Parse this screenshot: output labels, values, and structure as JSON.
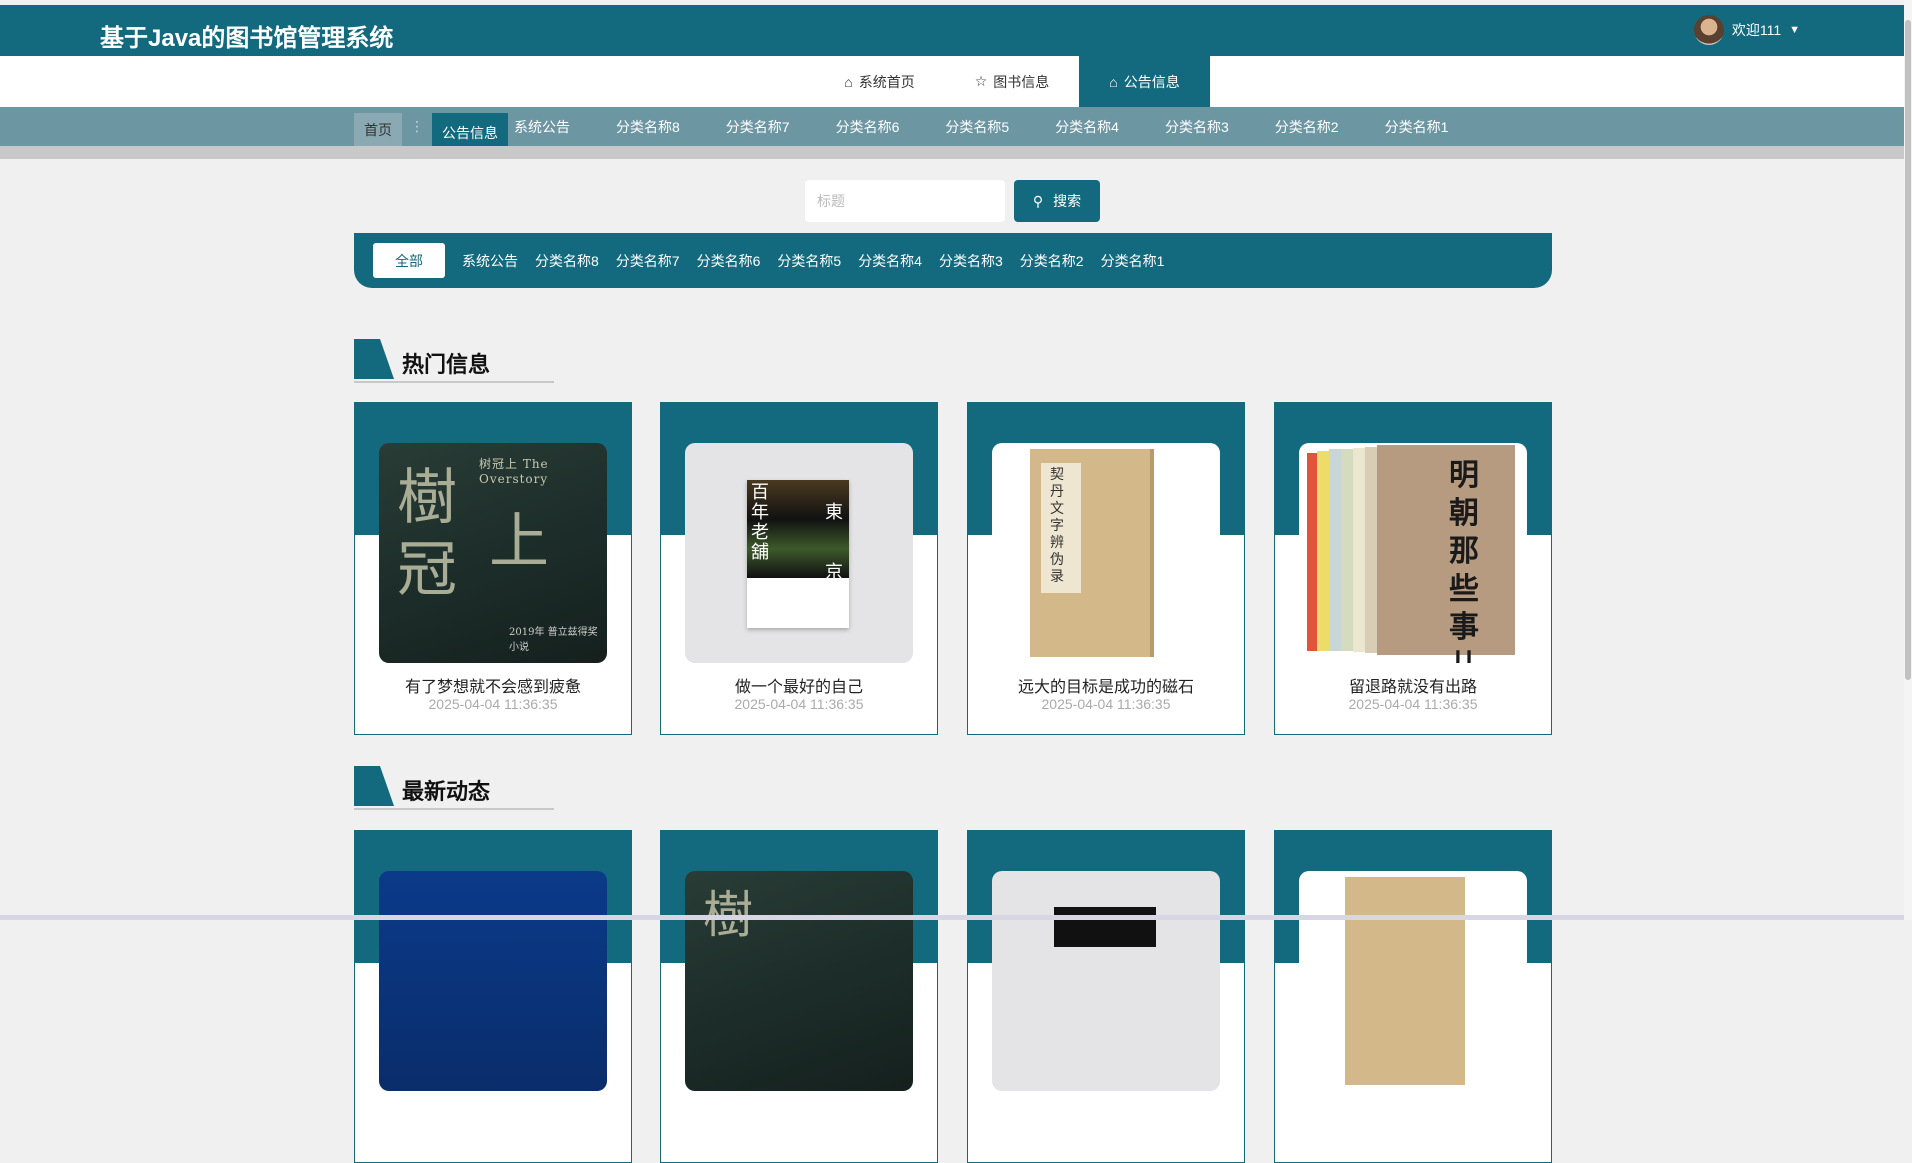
{
  "header": {
    "title": "基于Java的图书馆管理系统",
    "welcome": "欢迎111",
    "dropdown_icon": "▼"
  },
  "nav": [
    {
      "label": "系统首页",
      "icon": "home-icon"
    },
    {
      "label": "图书信息",
      "icon": "star-icon"
    },
    {
      "label": "公告信息",
      "icon": "bag-icon",
      "active": true
    }
  ],
  "breadcrumb": {
    "home": "首页",
    "separator": "⋮",
    "current": "公告信息"
  },
  "subnav_categories": [
    "系统公告",
    "分类名称8",
    "分类名称7",
    "分类名称6",
    "分类名称5",
    "分类名称4",
    "分类名称3",
    "分类名称2",
    "分类名称1"
  ],
  "search": {
    "placeholder": "标题",
    "button": "搜索"
  },
  "filter": {
    "all": "全部",
    "categories": [
      "系统公告",
      "分类名称8",
      "分类名称7",
      "分类名称6",
      "分类名称5",
      "分类名称4",
      "分类名称3",
      "分类名称2",
      "分类名称1"
    ]
  },
  "hot": {
    "title": "热门信息",
    "items": [
      {
        "title": "有了梦想就不会感到疲惫",
        "date": "2025-04-04 11:36:35",
        "cover_text": "树冠上 The Overstory"
      },
      {
        "title": "做一个最好的自己",
        "date": "2025-04-04 11:36:35",
        "cover_text": "百年老舖 東京"
      },
      {
        "title": "远大的目标是成功的磁石",
        "date": "2025-04-04 11:36:35",
        "cover_text": "契丹文字辨伪录"
      },
      {
        "title": "留退路就没有出路",
        "date": "2025-04-04 11:36:35",
        "cover_text": "明朝那些事儿"
      }
    ]
  },
  "latest": {
    "title": "最新动态"
  },
  "colors": {
    "primary": "#136a7e",
    "subnav": "#6d96a3",
    "background": "#f0f0f0"
  }
}
